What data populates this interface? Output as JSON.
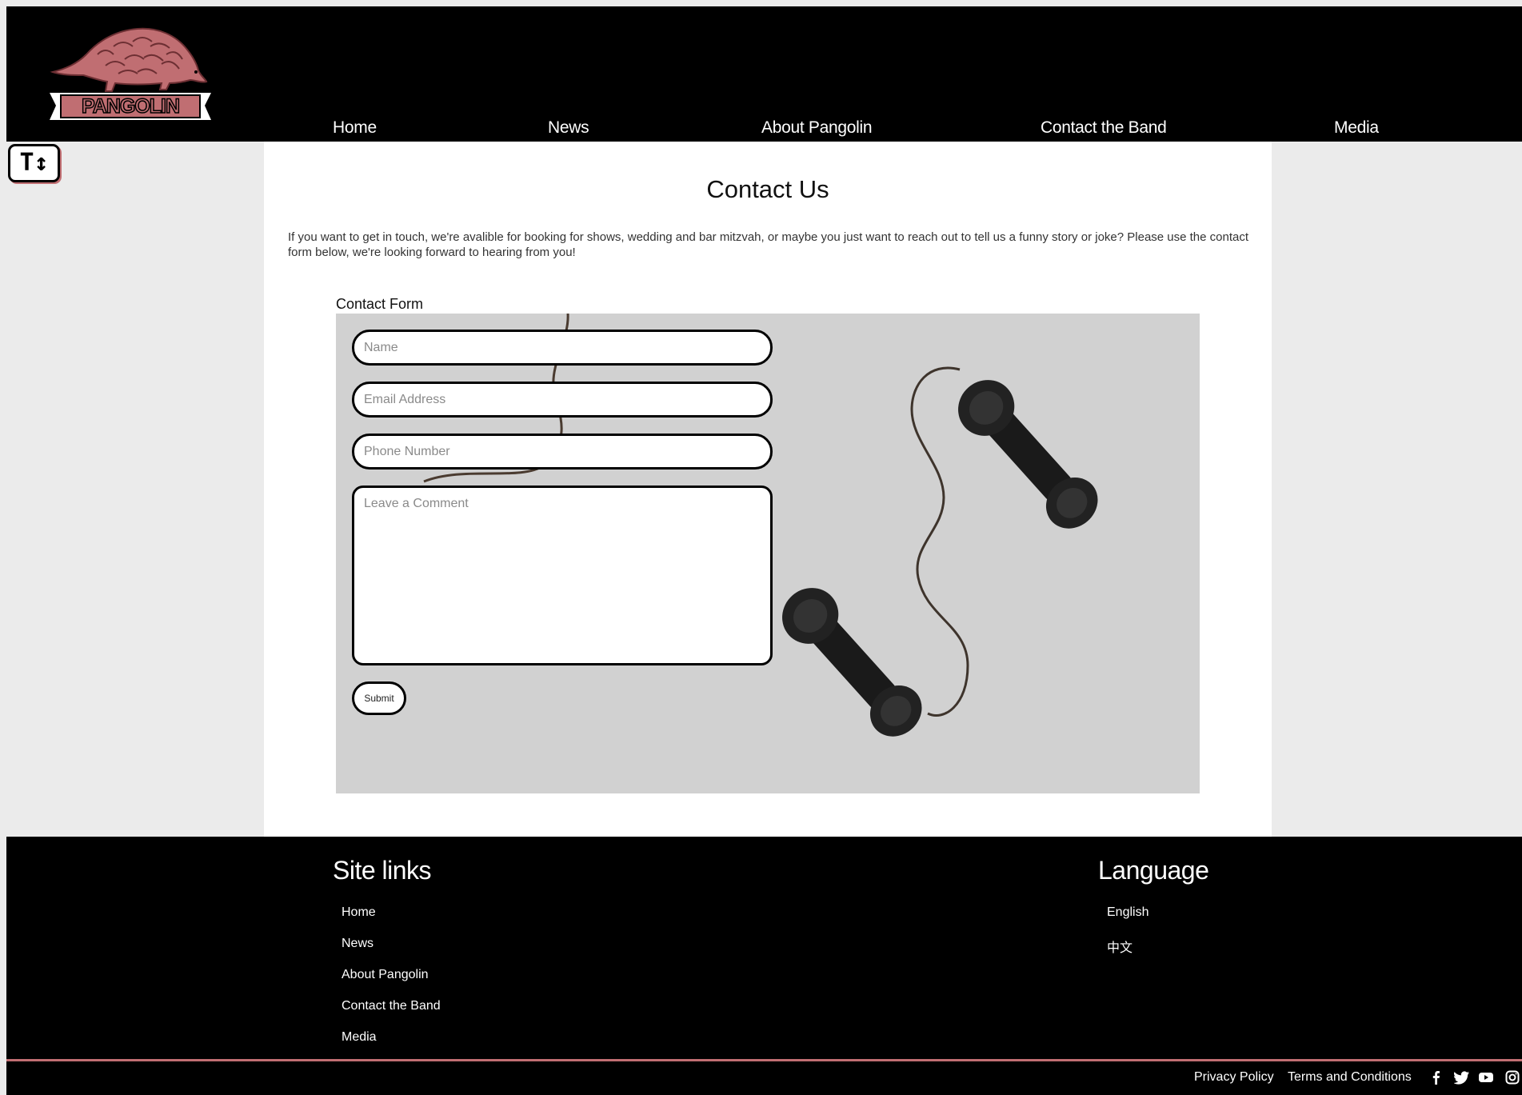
{
  "brand": {
    "name": "PANGOLIN",
    "accent": "#c06e72"
  },
  "nav": {
    "items": [
      {
        "label": "Home"
      },
      {
        "label": "News"
      },
      {
        "label": "About Pangolin"
      },
      {
        "label": "Contact the Band"
      },
      {
        "label": "Media"
      }
    ]
  },
  "accessibility": {
    "font_size_toggle_icon": "text-size-icon",
    "font_size_toggle_glyph": "T↕"
  },
  "main": {
    "title": "Contact Us",
    "intro": "If you want to get in touch, we're avalible for booking for shows, wedding and bar mitzvah, or maybe you just want to reach out to tell us a funny story or joke? Please use the contact form below, we're looking forward to hearing from you!",
    "form": {
      "label": "Contact Form",
      "name_placeholder": "Name",
      "email_placeholder": "Email Address",
      "phone_placeholder": "Phone Number",
      "comment_placeholder": "Leave a Comment",
      "submit_label": "Submit"
    }
  },
  "footer": {
    "site_links_heading": "Site links",
    "site_links": [
      {
        "label": "Home"
      },
      {
        "label": "News"
      },
      {
        "label": "About Pangolin"
      },
      {
        "label": "Contact the Band"
      },
      {
        "label": "Media"
      }
    ],
    "language_heading": "Language",
    "languages": [
      {
        "label": "English"
      },
      {
        "label": "中文"
      }
    ],
    "privacy_label": "Privacy Policy",
    "terms_label": "Terms and Conditions",
    "social": [
      "facebook-icon",
      "twitter-icon",
      "youtube-icon",
      "instagram-icon"
    ]
  }
}
